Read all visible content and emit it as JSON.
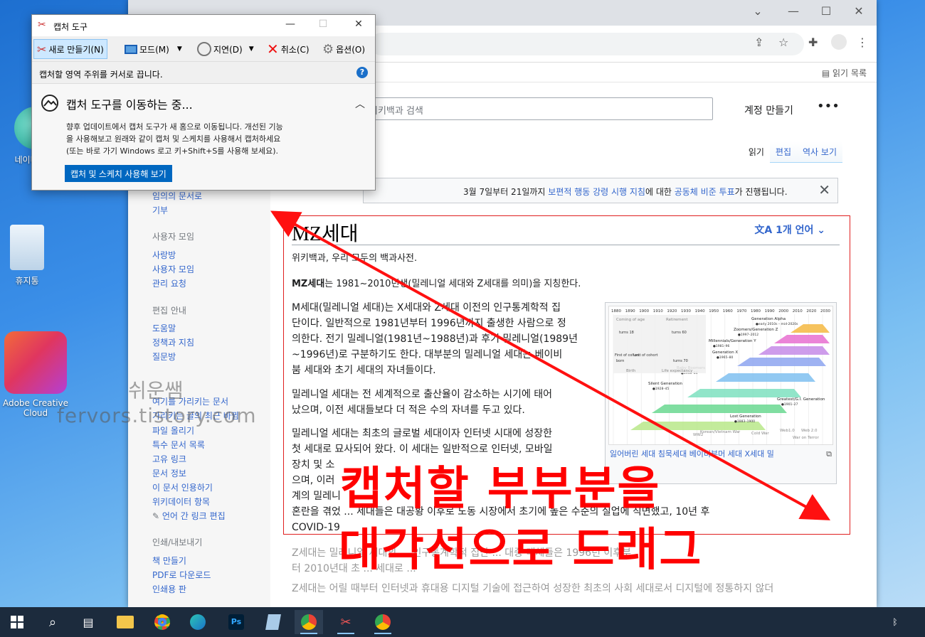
{
  "desktop": {
    "icons": [
      {
        "label": "네이버 웨일"
      },
      {
        "label": "휴지통"
      },
      {
        "label": "Adobe Creative Cloud"
      }
    ]
  },
  "browser": {
    "reading_list": "읽기 목록"
  },
  "wiki": {
    "search_placeholder": "위키백과 검색",
    "create_account": "계정 만들기",
    "more": "•••",
    "tabs": [
      "읽기",
      "편집",
      "역사 보기"
    ],
    "notice": {
      "pre": "3월 7일부터 21일까지 ",
      "link1": "보편적 행동 강령 시행 지침",
      "mid": "에 대한 ",
      "link2": "공동체 비준 투표",
      "post": "가 진행됩니다."
    },
    "sidebar": {
      "links_top": [
        "임의의 문서로",
        "기부"
      ],
      "head_users": "사용자 모임",
      "links_users": [
        "사랑방",
        "사용자 모임",
        "관리 요청"
      ],
      "head_edit": "편집 안내",
      "links_edit": [
        "도움말",
        "정책과 지침",
        "질문방"
      ],
      "links_tools": [
        "여기를 가리키는 문서",
        "가리키는 글의 최근 바뀜",
        "파일 올리기",
        "특수 문서 목록",
        "고유 링크",
        "문서 정보",
        "이 문서 인용하기",
        "위키데이터 항목",
        "언어 간 링크 편집"
      ],
      "head_print": "인쇄/내보내기",
      "links_print": [
        "책 만들기",
        "PDF로 다운로드",
        "인쇄용 판"
      ]
    },
    "title": "MZ세대",
    "lang_button": "1개 언어",
    "tagline": "위키백과, 우리 모두의 백과사전.",
    "lead_bold": "MZ세대",
    "lead_rest": "는 1981~2010년생(밀레니얼 세대와 Z세대를 의미)을 지칭한다.",
    "para1": [
      "M세대(밀레니얼 세대)는 X세대와 Z세대 이전의 인구통계학적 집",
      "단이다. 일반적으로 1981년부터 1996년까지 출생한 사람으로 정",
      "의한다. 전기 밀레니얼(1981년~1988년)과 후기 밀레니얼(1989년",
      "~1996년)로 구분하기도 한다. 대부분의 밀레니얼 세대는 베이비",
      "붐 세대와 초기 세대의 자녀들이다."
    ],
    "para2": [
      "밀레니얼 세대는 전 세계적으로 출산율이 감소하는 시기에 태어",
      "났으며, 이전 세대들보다 더 적은 수의 자녀를 두고 있다."
    ],
    "para3": [
      "밀레니얼 세대는 최초의 글로벌 세대이자 인터넷 시대에 성장한",
      "첫 세대로 묘사되어 왔다. 이 세대는 일반적으로 인터넷, 모바일",
      "장치 및 소",
      "으며, 이러",
      "계의 밀레니",
      "혼란을 겪었 ... 세대들은 대공황 이후로 노동 시장에서 초기에 높은 수준의 실업에 직면했고, 10년 후",
      "COVID-19"
    ],
    "para4": [
      "Z세대는 밀레니얼 세대의 ... 인구통계학적 집단 ... 대중 매체들은 1996년 이후부",
      "터 2010년대 초 ... 세대로 ..."
    ],
    "para5": "Z세대는 어릴 때부터 인터넷과 휴대용 디지털 기술에 접근하여 성장한 최초의 사회 세대로서 디지털에 정통하지 않더",
    "infobox_caption": "잃어버린 세대 침묵세대 베이비부머 세대 X세대 밀",
    "chart_years": [
      "1880",
      "1890",
      "1900",
      "1910",
      "1920",
      "1930",
      "1940",
      "1950",
      "1960",
      "1970",
      "1980",
      "1990",
      "2000",
      "2010",
      "2020",
      "2030"
    ],
    "chart_labels": {
      "coming_of_age": "Coming of age",
      "retirement": "Retirement",
      "gen_alpha": "Generation Alpha",
      "gen_alpha_sub": "●early 2010s – mid-2020s",
      "zoomers": "Zoomers/Generation Z",
      "zoomers_sub": "●1997–2012",
      "millennials": "Millennials/Generation Y",
      "millennials_sub": "●1981–96",
      "genx": "Generation X",
      "genx_sub": "●1965–80",
      "boomers": "Baby Boomers",
      "boomers_sub": "●1946–64",
      "silent": "Silent Generation",
      "silent_sub": "●1928–45",
      "greatest": "Greatest/G.I. Generation",
      "greatest_sub": "●1901–27",
      "lost": "Lost Generation",
      "lost_sub": "●1883–1900",
      "birth": "Birth",
      "life_exp": "Life expectancy",
      "first_cohort": "First of cohort",
      "last_cohort": "Last of cohort",
      "turns18": "turns 18",
      "turns60": "turns 60",
      "turns70": "turns 70",
      "born": "born",
      "ww2": "WW2",
      "korean_vietnam": "Korean/Vietnam War",
      "cold_war": "Cold War",
      "web10": "Web1.0",
      "web20": "Web 2.0",
      "war_on_terror": "War on Terror"
    }
  },
  "snip": {
    "title": "캡처 도구",
    "new": "새로 만들기(N)",
    "mode": "모드(M)",
    "delay": "지연(D)",
    "cancel": "취소(C)",
    "options": "옵션(O)",
    "hint": "캡처할 영역 주위를 커서로 끕니다.",
    "promo_head": "캡처 도구를 이동하는 중...",
    "promo_body": [
      "향후 업데이트에서 캡처 도구가 새 홈으로 이동됩니다. 개선된 기능",
      "을 사용해보고 원래와 같이 캡처 및 스케치를 사용해서 캡처하세요",
      "(또는 바로 가기 Windows 로고 키+Shift+S를 사용해 보세요)."
    ],
    "promo_button": "캡처 및 스케치 사용해 보기"
  },
  "overlay": {
    "line1": "캡처할 부부분을",
    "line2": "대각선으로 드래그"
  },
  "watermark": {
    "line1": "쉬운쌤",
    "line2": "fervors.tistory.com"
  },
  "colors": {
    "accent_red": "#ff0000",
    "link_blue": "#3366cc",
    "button_blue": "#0067c0"
  }
}
